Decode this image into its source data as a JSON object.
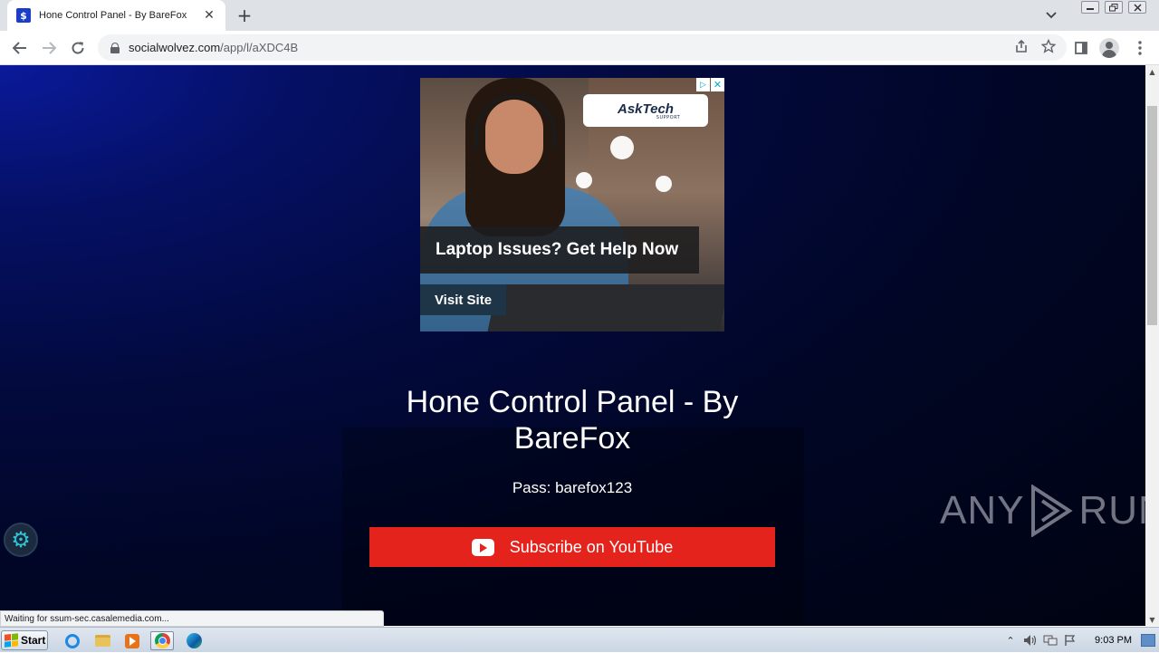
{
  "browser": {
    "tab_title": "Hone Control Panel - By BareFox",
    "favicon_char": "$",
    "tab_close": "✕",
    "new_tab": "+",
    "url_host": "socialwolvez.com",
    "url_path": "/app/l/aXDC4B",
    "status_text": "Waiting for ssum-sec.casalemedia.com..."
  },
  "ad": {
    "brand": "AskTech",
    "brand_sub": "SUPPORT",
    "headline": "Laptop Issues? Get Help Now",
    "cta": "Visit Site"
  },
  "page": {
    "title": "Hone Control Panel - By BareFox",
    "pass": "Pass: barefox123",
    "youtube_button": "Subscribe on YouTube"
  },
  "watermark": {
    "left": "ANY",
    "right": "RUN"
  },
  "taskbar": {
    "start_label": "Start",
    "clock": "9:03 PM"
  },
  "colors": {
    "youtube_red": "#e5231d",
    "page_bg": "#020a3e",
    "tab_strip": "#dee1e6"
  }
}
